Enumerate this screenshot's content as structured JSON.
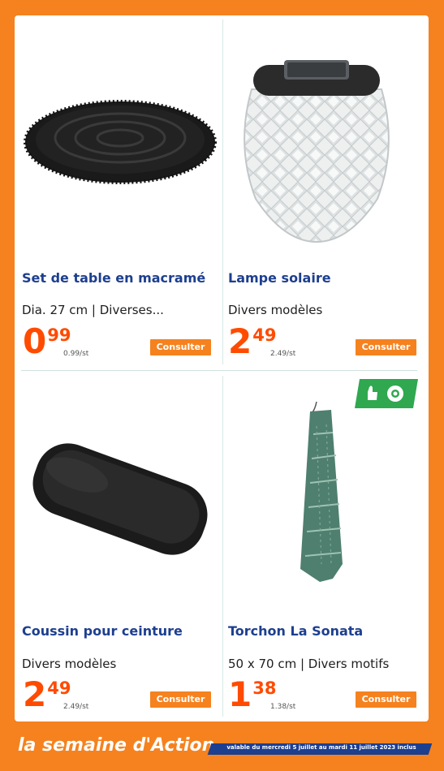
{
  "products": [
    {
      "title": "Set de table en macramé",
      "description": "Dia. 27 cm | Diverses...",
      "price_int": "0",
      "price_dec": "99",
      "unit_price": "0.99/st",
      "button": "Consulter"
    },
    {
      "title": "Lampe solaire",
      "description": "Divers modèles",
      "price_int": "2",
      "price_dec": "49",
      "unit_price": "2.49/st",
      "button": "Consulter"
    },
    {
      "title": "Coussin pour ceinture",
      "description": "Divers modèles",
      "price_int": "2",
      "price_dec": "49",
      "unit_price": "2.49/st",
      "button": "Consulter"
    },
    {
      "title": "Torchon La Sonata",
      "description": "50 x 70 cm | Divers motifs",
      "price_int": "1",
      "price_dec": "38",
      "unit_price": "1.38/st",
      "button": "Consulter"
    }
  ],
  "footer": {
    "brand_line": "la semaine d'Action",
    "validity": "valable du mercredi 5 juillet au mardi 11 juillet 2023 inclus"
  },
  "colors": {
    "brand_orange": "#f5821f",
    "title_blue": "#1d3f8f",
    "price_orange": "#ff4b00",
    "eco_green": "#2fa84f"
  }
}
